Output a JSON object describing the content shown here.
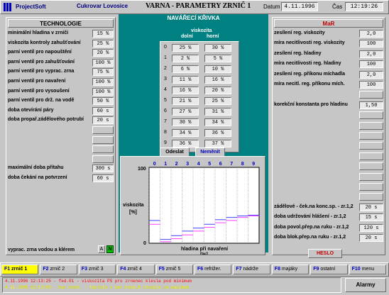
{
  "header": {
    "logo": "ProjectSoft",
    "company": "Cukrovar Lovosice",
    "title": "VARNA  -  PARAMETRY ZRNIČ 1",
    "date_label": "Datum",
    "date_value": "4.11.1996",
    "time_label": "Čas",
    "time_value": "12:19:26"
  },
  "left": {
    "title": "TECHNOLOGIE",
    "rows": [
      {
        "label": "minimální hladina v zrniči",
        "value": "15 %"
      },
      {
        "label": "viskozita kontroly zahušťování",
        "value": "25 %"
      },
      {
        "label": "parní ventil pro napouštění",
        "value": "20 %"
      },
      {
        "label": "parní ventil pro zahušťování",
        "value": "100 %"
      },
      {
        "label": "parní ventil pro vyprac. zrna",
        "value": "75 %"
      },
      {
        "label": "parní ventil pro navaření",
        "value": "100 %"
      },
      {
        "label": "parní ventil pro vysoušení",
        "value": "100 %"
      },
      {
        "label": "parní ventil pro drž. na vodě",
        "value": "50 %"
      },
      {
        "label": "doba otevírání páry",
        "value": "60 s"
      },
      {
        "label": "doba propař.zádělového potrubí",
        "value": "20 s"
      },
      {
        "label": "",
        "value": ""
      },
      {
        "label": "",
        "value": ""
      },
      {
        "label": "",
        "value": ""
      },
      {
        "label": "",
        "value": ""
      },
      {
        "label": "maximální doba přítahu",
        "value": "300 s"
      },
      {
        "label": "doba čekání na potvrzení",
        "value": "60 s"
      }
    ],
    "bottom_label": "vyprac. zrna vodou a klérem",
    "toggle_a": "A",
    "toggle_n": "N"
  },
  "center": {
    "title": "NAVÁŘECÍ KŘIVKA",
    "col_title": "viskozita",
    "col_lower": "dolní",
    "col_upper": "horní",
    "table": [
      {
        "idx": "0",
        "lower": "25 %",
        "upper": "30 %"
      },
      {
        "idx": "1",
        "lower": "2 %",
        "upper": "5 %"
      },
      {
        "idx": "2",
        "lower": "6 %",
        "upper": "10 %"
      },
      {
        "idx": "3",
        "lower": "11 %",
        "upper": "16 %"
      },
      {
        "idx": "4",
        "lower": "16 %",
        "upper": "20 %"
      },
      {
        "idx": "5",
        "lower": "21 %",
        "upper": "25 %"
      },
      {
        "idx": "6",
        "lower": "27 %",
        "upper": "31 %"
      },
      {
        "idx": "7",
        "lower": "30 %",
        "upper": "34 %"
      },
      {
        "idx": "8",
        "lower": "34 %",
        "upper": "36 %"
      },
      {
        "idx": "9",
        "lower": "36 %",
        "upper": "37 %"
      }
    ],
    "send_button": "Odeslat",
    "change_button": "Neměnit"
  },
  "chart_data": {
    "type": "line",
    "x": [
      0,
      1,
      2,
      3,
      4,
      5,
      6,
      7,
      8,
      9
    ],
    "x_tick_labels": [
      "0",
      "1",
      "2",
      "3",
      "4",
      "5",
      "6",
      "7",
      "8",
      "9"
    ],
    "series": [
      {
        "name": "horní",
        "color": "#4040ff",
        "values": [
          30,
          5,
          10,
          16,
          20,
          25,
          31,
          34,
          36,
          37
        ]
      },
      {
        "name": "dolní",
        "color": "#ff40ff",
        "values": [
          25,
          2,
          6,
          11,
          16,
          21,
          27,
          30,
          34,
          36
        ]
      }
    ],
    "ylabel": "viskozita",
    "ylabel_unit": "[%]",
    "xlabel": "hladina při navaření",
    "xlabel_unit": "[%]",
    "y_tick_labels": [
      "100",
      "0"
    ],
    "ylim": [
      0,
      100
    ],
    "grid": "vertical"
  },
  "right": {
    "title": "MaR",
    "rows": [
      {
        "label": "zesílení reg. viskozity",
        "value": "2,0"
      },
      {
        "label": "míra necitlivosti reg. viskozity",
        "value": "100"
      },
      {
        "label": "zesílení reg. hladiny",
        "value": "2,0"
      },
      {
        "label": "míra necitlivosti reg. hladiny",
        "value": "100"
      },
      {
        "label": "zesílení reg. příkonu míchadla",
        "value": "2,0"
      },
      {
        "label": "míra necitl. reg. příkonu mích.",
        "value": "100"
      },
      {
        "label": "",
        "value": ""
      },
      {
        "label": "korekční konstanta pro hladinu",
        "value": "1,50"
      },
      {
        "label": "",
        "value": ""
      },
      {
        "label": "",
        "value": ""
      },
      {
        "label": "",
        "value": ""
      },
      {
        "label": "",
        "value": ""
      },
      {
        "label": "",
        "value": ""
      },
      {
        "label": "",
        "value": ""
      },
      {
        "label": "",
        "value": ""
      },
      {
        "label": "",
        "value": ""
      },
      {
        "label": "",
        "value": ""
      },
      {
        "label": "zádělové - ček.na konc.sp. - zr.1,2",
        "value": "20 s"
      },
      {
        "label": "doba udržování hlášení - zr.1,2",
        "value": "15 s"
      },
      {
        "label": "doba povol.přep.na ruku - zr.1,2",
        "value": "120 s"
      },
      {
        "label": "doba blok.přep.na ruku - zr.1,2",
        "value": "20 s"
      }
    ],
    "password_button": "HESLO"
  },
  "fkeys": [
    {
      "key": "F1",
      "label": "zrnič 1",
      "active": true
    },
    {
      "key": "F2",
      "label": "zrnič 2",
      "active": false
    },
    {
      "key": "F3",
      "label": "zrnič 3",
      "active": false
    },
    {
      "key": "F4",
      "label": "zrnič 4",
      "active": false
    },
    {
      "key": "F5",
      "label": "zrnič 5",
      "active": false
    },
    {
      "key": "F6",
      "label": "refrižer.",
      "active": false
    },
    {
      "key": "F7",
      "label": "nádrže",
      "active": false
    },
    {
      "key": "F8",
      "label": "majáky",
      "active": false
    },
    {
      "key": "F9",
      "label": "ostatní",
      "active": false
    },
    {
      "key": "F10",
      "label": "menu",
      "active": false
    }
  ],
  "alarms": {
    "line1": "4.11.1996  12:13:25 - fed.01  -   viskozita PS pro zrnenec klesla pod minimum",
    "line2": "4.11.1996  12:13:05 - bar.kond.  : teplota v bar.kond.B stoupla na maximum",
    "button": "Alarmy"
  }
}
